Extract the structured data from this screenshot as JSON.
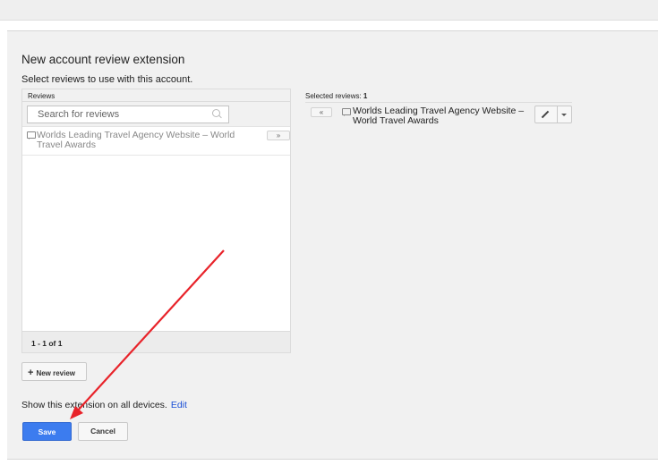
{
  "page": {
    "title": "New account review extension",
    "subtitle": "Select reviews to use with this account."
  },
  "reviews_panel": {
    "header": "Reviews",
    "search_placeholder": "Search for reviews",
    "items": [
      {
        "label": "Worlds Leading Travel Agency Website – World Travel Awards",
        "add_label": "»"
      }
    ],
    "pager": "1 - 1 of 1"
  },
  "new_review_button": {
    "icon": "+",
    "label": "New review"
  },
  "selected_panel": {
    "header_prefix": "Selected reviews: ",
    "count": "1",
    "remove_label": "«",
    "items": [
      {
        "label": "Worlds Leading Travel Agency Website – World Travel Awards"
      }
    ]
  },
  "devices": {
    "text": "Show this extension on all devices.",
    "edit_label": "Edit"
  },
  "actions": {
    "save_label": "Save",
    "cancel_label": "Cancel"
  },
  "colors": {
    "primary_button": "#3c7cef",
    "link": "#1a4fd6",
    "annotation_arrow": "#e8232a",
    "panel_bg": "#f1f1f1"
  }
}
